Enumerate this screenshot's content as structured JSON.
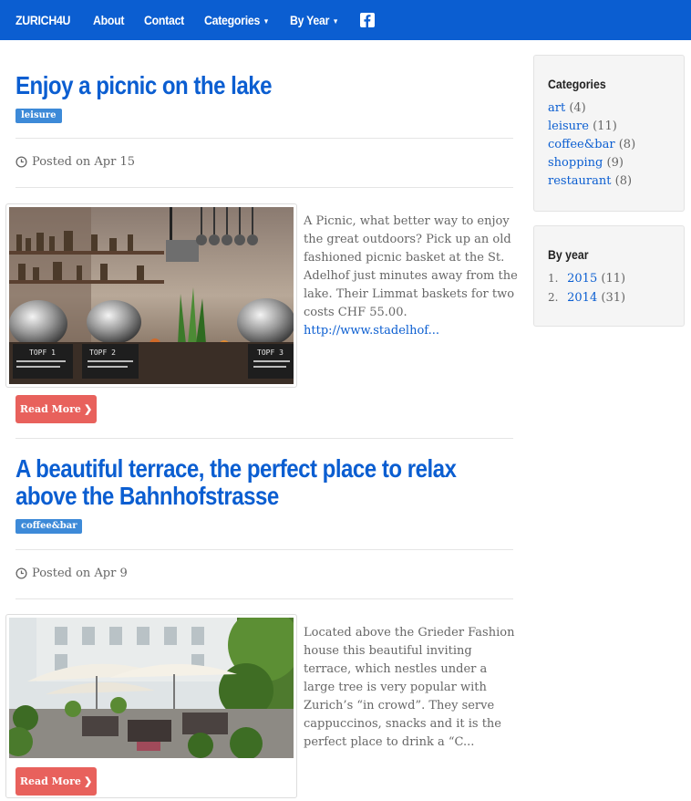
{
  "navbar": {
    "brand": "ZURICH4U",
    "items": [
      {
        "label": "About"
      },
      {
        "label": "Contact"
      },
      {
        "label": "Categories"
      },
      {
        "label": "By Year"
      }
    ],
    "facebook_icon": "facebook-icon",
    "color": "#0b5ed1"
  },
  "posts": [
    {
      "title": "Enjoy a picnic on the lake",
      "tag": "leisure",
      "posted": "Posted on Apr 15",
      "excerpt": "A Picnic, what better way to enjoy the great outdoors? Pick up an old fashioned picnic basket at the St. Adelhof just minutes away from the lake. Their Limmat baskets for two costs CHF 55.00.",
      "link": "http://www.stadelhof...",
      "read_more": "Read More",
      "image_labels": [
        "TOPF 1",
        "TOPF 2",
        "TOPF 3"
      ]
    },
    {
      "title_line1": "A beautiful terrace, the perfect place to relax",
      "title_line2": "above the Bahnhofstrasse",
      "tag": "coffee&bar",
      "posted": "Posted on Apr 9",
      "excerpt": "Located above the Grieder Fashion house this beautiful inviting terrace, which nestles under a large tree is very popular with Zurich’s  “in crowd”. They serve cappuccinos, snacks and it is the perfect place to drink a “C...",
      "read_more": "Read More"
    }
  ],
  "sidebar": {
    "categories_title": "Categories",
    "categories": [
      {
        "name": "art",
        "count": "(4)"
      },
      {
        "name": "leisure",
        "count": "(11)"
      },
      {
        "name": "coffee&bar",
        "count": "(8)"
      },
      {
        "name": "shopping",
        "count": "(9)"
      },
      {
        "name": "restaurant",
        "count": "(8)"
      }
    ],
    "years_title": "By year",
    "years": [
      {
        "num": "1.",
        "year": "2015",
        "count": "(11)"
      },
      {
        "num": "2.",
        "year": "2014",
        "count": "(31)"
      }
    ]
  },
  "colors": {
    "brand_blue": "#0b5ed1",
    "tag_blue": "#3d8ad8",
    "read_more_red": "#e8615c"
  }
}
